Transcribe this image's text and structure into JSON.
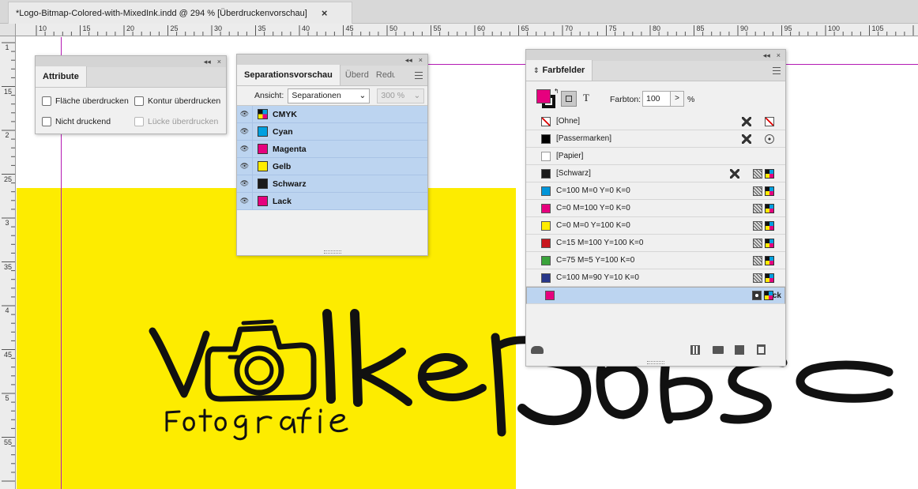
{
  "document_tab": {
    "title": "*Logo-Bitmap-Colored-with-MixedInk.indd @ 294 % [Überdruckenvorschau]",
    "close": "×"
  },
  "ruler": {
    "h_labels": [
      "10",
      "15",
      "20",
      "25",
      "30",
      "35",
      "40",
      "45",
      "50",
      "55",
      "60",
      "65",
      "70",
      "75",
      "80",
      "85",
      "90",
      "95",
      "100",
      "105"
    ],
    "v_labels": [
      "1",
      "15",
      "2",
      "25",
      "3",
      "35",
      "4",
      "45",
      "5",
      "55"
    ]
  },
  "attribute_panel": {
    "tab": "Attribute",
    "collapse": "◂◂",
    "close": "×",
    "options": {
      "flaeche": "Fläche überdrucken",
      "kontur": "Kontur überdrucken",
      "nicht_druckend": "Nicht druckend",
      "luecke": "Lücke überdrucken"
    }
  },
  "sep_panel": {
    "tabs": [
      "Separationsvorschau",
      "Überd",
      "Redu"
    ],
    "collapse": "◂◂",
    "close": "×",
    "ansicht_label": "Ansicht:",
    "ansicht_value": "Separationen",
    "percent_value": "300 %",
    "rows": [
      {
        "label": "CMYK",
        "color": "cmyk"
      },
      {
        "label": "Cyan",
        "color": "#00a0e0"
      },
      {
        "label": "Magenta",
        "color": "#e6007e"
      },
      {
        "label": "Gelb",
        "color": "#ffec00"
      },
      {
        "label": "Schwarz",
        "color": "#1a1a1a"
      },
      {
        "label": "Lack",
        "color": "#e6007e"
      }
    ]
  },
  "farbfelder_panel": {
    "title": "Farbfelder",
    "collapse": "◂◂",
    "close": "×",
    "farbton_label": "Farbton:",
    "farbton_value": "100",
    "percent": "%",
    "stepper": ">",
    "text_toggle": "T",
    "swatches": [
      {
        "label": "[Ohne]",
        "color": "none",
        "icons": [
          "pencil-off",
          "none-box"
        ]
      },
      {
        "label": "[Passermarken]",
        "color": "#000000",
        "icons": [
          "pencil-off",
          "registration"
        ]
      },
      {
        "label": "[Papier]",
        "color": "#ffffff",
        "icons": []
      },
      {
        "label": "[Schwarz]",
        "color": "#1a1a1a",
        "icons": [
          "pencil-off",
          "process",
          "cmyk"
        ]
      },
      {
        "label": "C=100 M=0 Y=0 K=0",
        "color": "#0095d9",
        "icons": [
          "process",
          "cmyk"
        ]
      },
      {
        "label": "C=0 M=100 Y=0 K=0",
        "color": "#e6007e",
        "icons": [
          "process",
          "cmyk"
        ]
      },
      {
        "label": "C=0 M=0 Y=100 K=0",
        "color": "#ffec00",
        "icons": [
          "process",
          "cmyk"
        ]
      },
      {
        "label": "C=15 M=100 Y=100 K=0",
        "color": "#c8161d",
        "icons": [
          "process",
          "cmyk"
        ]
      },
      {
        "label": "C=75 M=5 Y=100 K=0",
        "color": "#3aa33b",
        "icons": [
          "process",
          "cmyk"
        ]
      },
      {
        "label": "C=100 M=90 Y=10 K=0",
        "color": "#28378a",
        "icons": [
          "process",
          "cmyk"
        ]
      },
      {
        "label": "Lack",
        "color": "#e6007e",
        "icons": [
          "spot",
          "cmyk"
        ],
        "selected": true
      }
    ]
  },
  "colors": {
    "yellow_area": "#fdec00",
    "guide": "#b41ab4",
    "selection": "#bcd4f0",
    "magenta": "#e6007e"
  }
}
